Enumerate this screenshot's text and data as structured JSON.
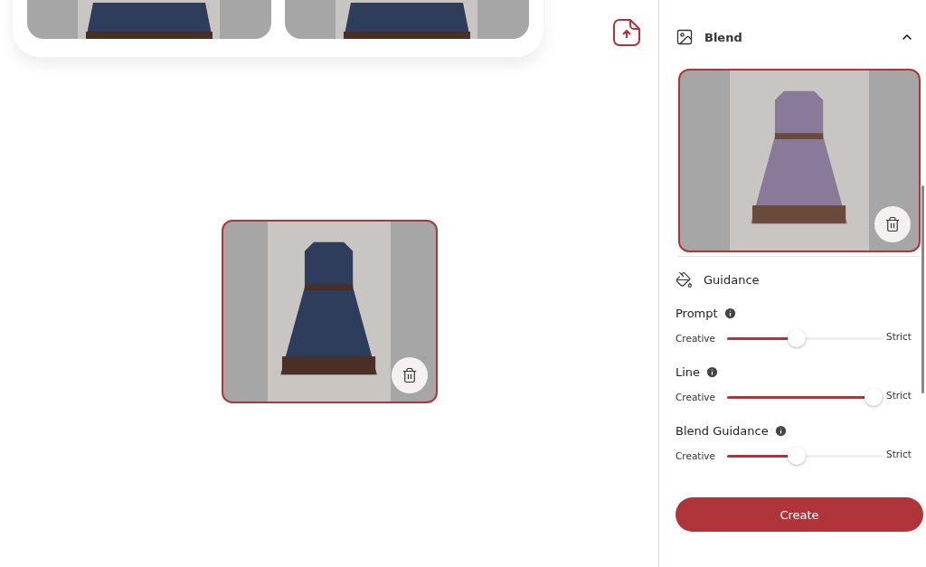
{
  "canvas": {
    "top_images": [
      {
        "kind": "navy"
      },
      {
        "kind": "navy"
      }
    ],
    "center_image": {
      "kind": "navy",
      "selected": true
    }
  },
  "panel": {
    "blend": {
      "title": "Blend",
      "expanded": true,
      "image": {
        "kind": "purple",
        "selected": true
      }
    },
    "guidance": {
      "title": "Guidance",
      "sliders": [
        {
          "label": "Prompt",
          "min_label": "Creative",
          "max_label": "Strict",
          "level": 0.44
        },
        {
          "label": "Line",
          "min_label": "Creative",
          "max_label": "Strict",
          "level": 1.0
        },
        {
          "label": "Blend Guidance",
          "min_label": "Creative",
          "max_label": "Strict",
          "level": 0.44
        }
      ]
    },
    "create_button": "Create"
  }
}
